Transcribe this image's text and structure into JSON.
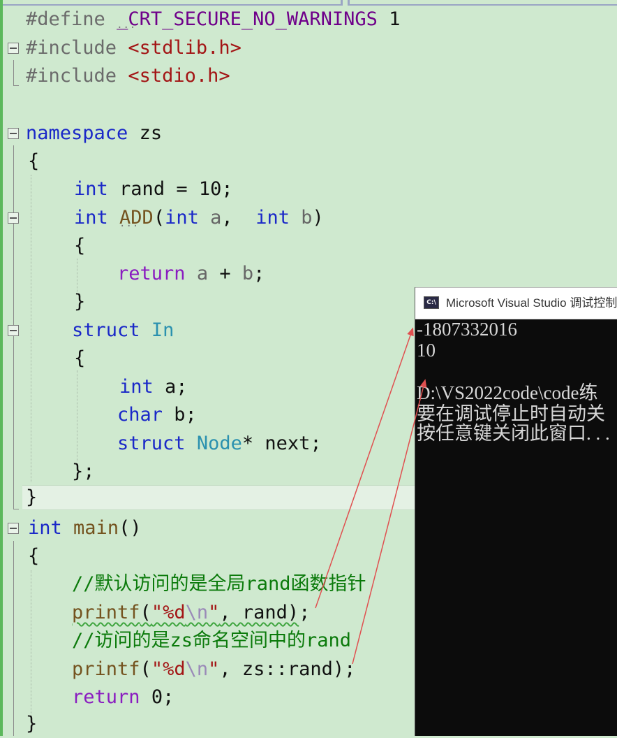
{
  "editor": {
    "code_lines": {
      "l1": {
        "define": "#define",
        "macro": "_CRT_SECURE_NO_WARNINGS",
        "value": "1"
      },
      "l2": {
        "include": "#include",
        "header": "<stdlib.h>"
      },
      "l3": {
        "include": "#include",
        "header": "<stdio.h>"
      },
      "l5": {
        "kw": "namespace",
        "name": "zs"
      },
      "l6": {
        "brace": "{"
      },
      "l7": {
        "kw": "int",
        "rest": "rand = 10;"
      },
      "l8": {
        "kw": "int",
        "fn": "ADD",
        "open": "(",
        "kw_a": "int",
        "a": "a",
        "comma": ",",
        "kw_b": "int",
        "b": "b",
        "close": ")"
      },
      "l9": {
        "brace": "{"
      },
      "l10": {
        "kw": "return",
        "a": "a",
        "op": "+",
        "b": "b",
        "semi": ";"
      },
      "l11": {
        "brace": "}"
      },
      "l12": {
        "kw": "struct",
        "type": "In"
      },
      "l13": {
        "brace": "{"
      },
      "l14": {
        "kw": "int",
        "rest": "a;"
      },
      "l15": {
        "kw": "char",
        "rest": "b;"
      },
      "l16": {
        "kw": "struct",
        "type": "Node",
        "rest": "* next;"
      },
      "l17": {
        "brace": "};"
      },
      "l18": {
        "brace": "}"
      },
      "l19": {
        "kw": "int",
        "fn": "main",
        "parens": "()"
      },
      "l20": {
        "brace": "{"
      },
      "l21": {
        "comment": "//默认访问的是全局rand函数指针"
      },
      "l22": {
        "fn": "printf",
        "open": "(",
        "str": "\"%d",
        "esc": "\\n",
        "strend": "\"",
        "rest": ", rand)",
        "semi": ";"
      },
      "l23": {
        "comment": "//访问的是zs命名空间中的rand"
      },
      "l24": {
        "fn": "printf",
        "open": "(",
        "str": "\"%d",
        "esc": "\\n",
        "strend": "\"",
        "rest": ", zs::rand);"
      },
      "l25": {
        "kw": "return",
        "rest": "0;"
      },
      "l26": {
        "brace": "}"
      }
    }
  },
  "console": {
    "title": "Microsoft Visual Studio 调试控制",
    "icon_label": "C:\\",
    "lines": [
      "-1807332016",
      "10",
      "",
      "D:\\VS2022code\\code练",
      "要在调试停止时自动关",
      "按任意键关闭此窗口. . ."
    ]
  },
  "colors": {
    "editor_bg": "#cfe9cf",
    "keyword": "#1a28c8",
    "return_keyword": "#8a1cc0",
    "comment": "#0b7a0b",
    "string": "#a31515",
    "type": "#2b91af",
    "console_bg": "#0c0c0c",
    "arrow": "#e05050"
  }
}
